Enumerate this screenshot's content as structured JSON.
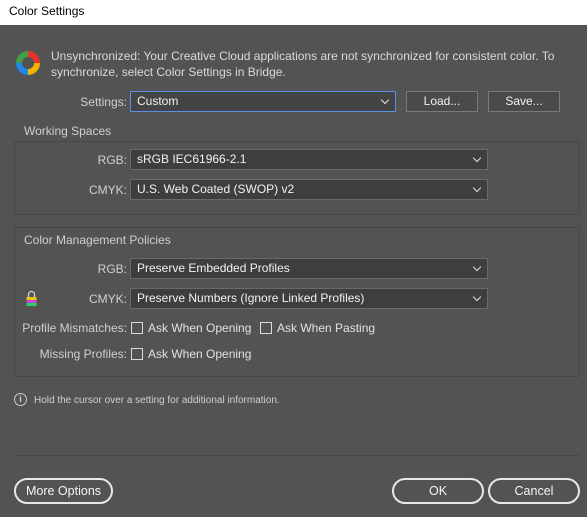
{
  "window": {
    "title": "Color Settings"
  },
  "sync": {
    "icon": "creative-cloud-sync-icon",
    "message": "Unsynchronized: Your Creative Cloud applications are not synchronized for consistent color. To synchronize, select Color Settings in Bridge."
  },
  "settings": {
    "label": "Settings:",
    "value": "Custom",
    "load_label": "Load...",
    "save_label": "Save..."
  },
  "working_spaces": {
    "title": "Working Spaces",
    "rgb_label": "RGB:",
    "rgb_value": "sRGB IEC61966-2.1",
    "cmyk_label": "CMYK:",
    "cmyk_value": "U.S. Web Coated (SWOP) v2"
  },
  "policies": {
    "title": "Color Management Policies",
    "rgb_label": "RGB:",
    "rgb_value": "Preserve Embedded Profiles",
    "cmyk_label": "CMYK:",
    "cmyk_value": "Preserve Numbers (Ignore Linked Profiles)",
    "mismatch_label": "Profile Mismatches:",
    "mismatch_opening": "Ask When Opening",
    "mismatch_pasting": "Ask When Pasting",
    "missing_label": "Missing Profiles:",
    "missing_opening": "Ask When Opening"
  },
  "info": {
    "icon": "info-icon",
    "text": "Hold the cursor over a setting for additional information."
  },
  "footer": {
    "more_options": "More Options",
    "ok": "OK",
    "cancel": "Cancel"
  }
}
